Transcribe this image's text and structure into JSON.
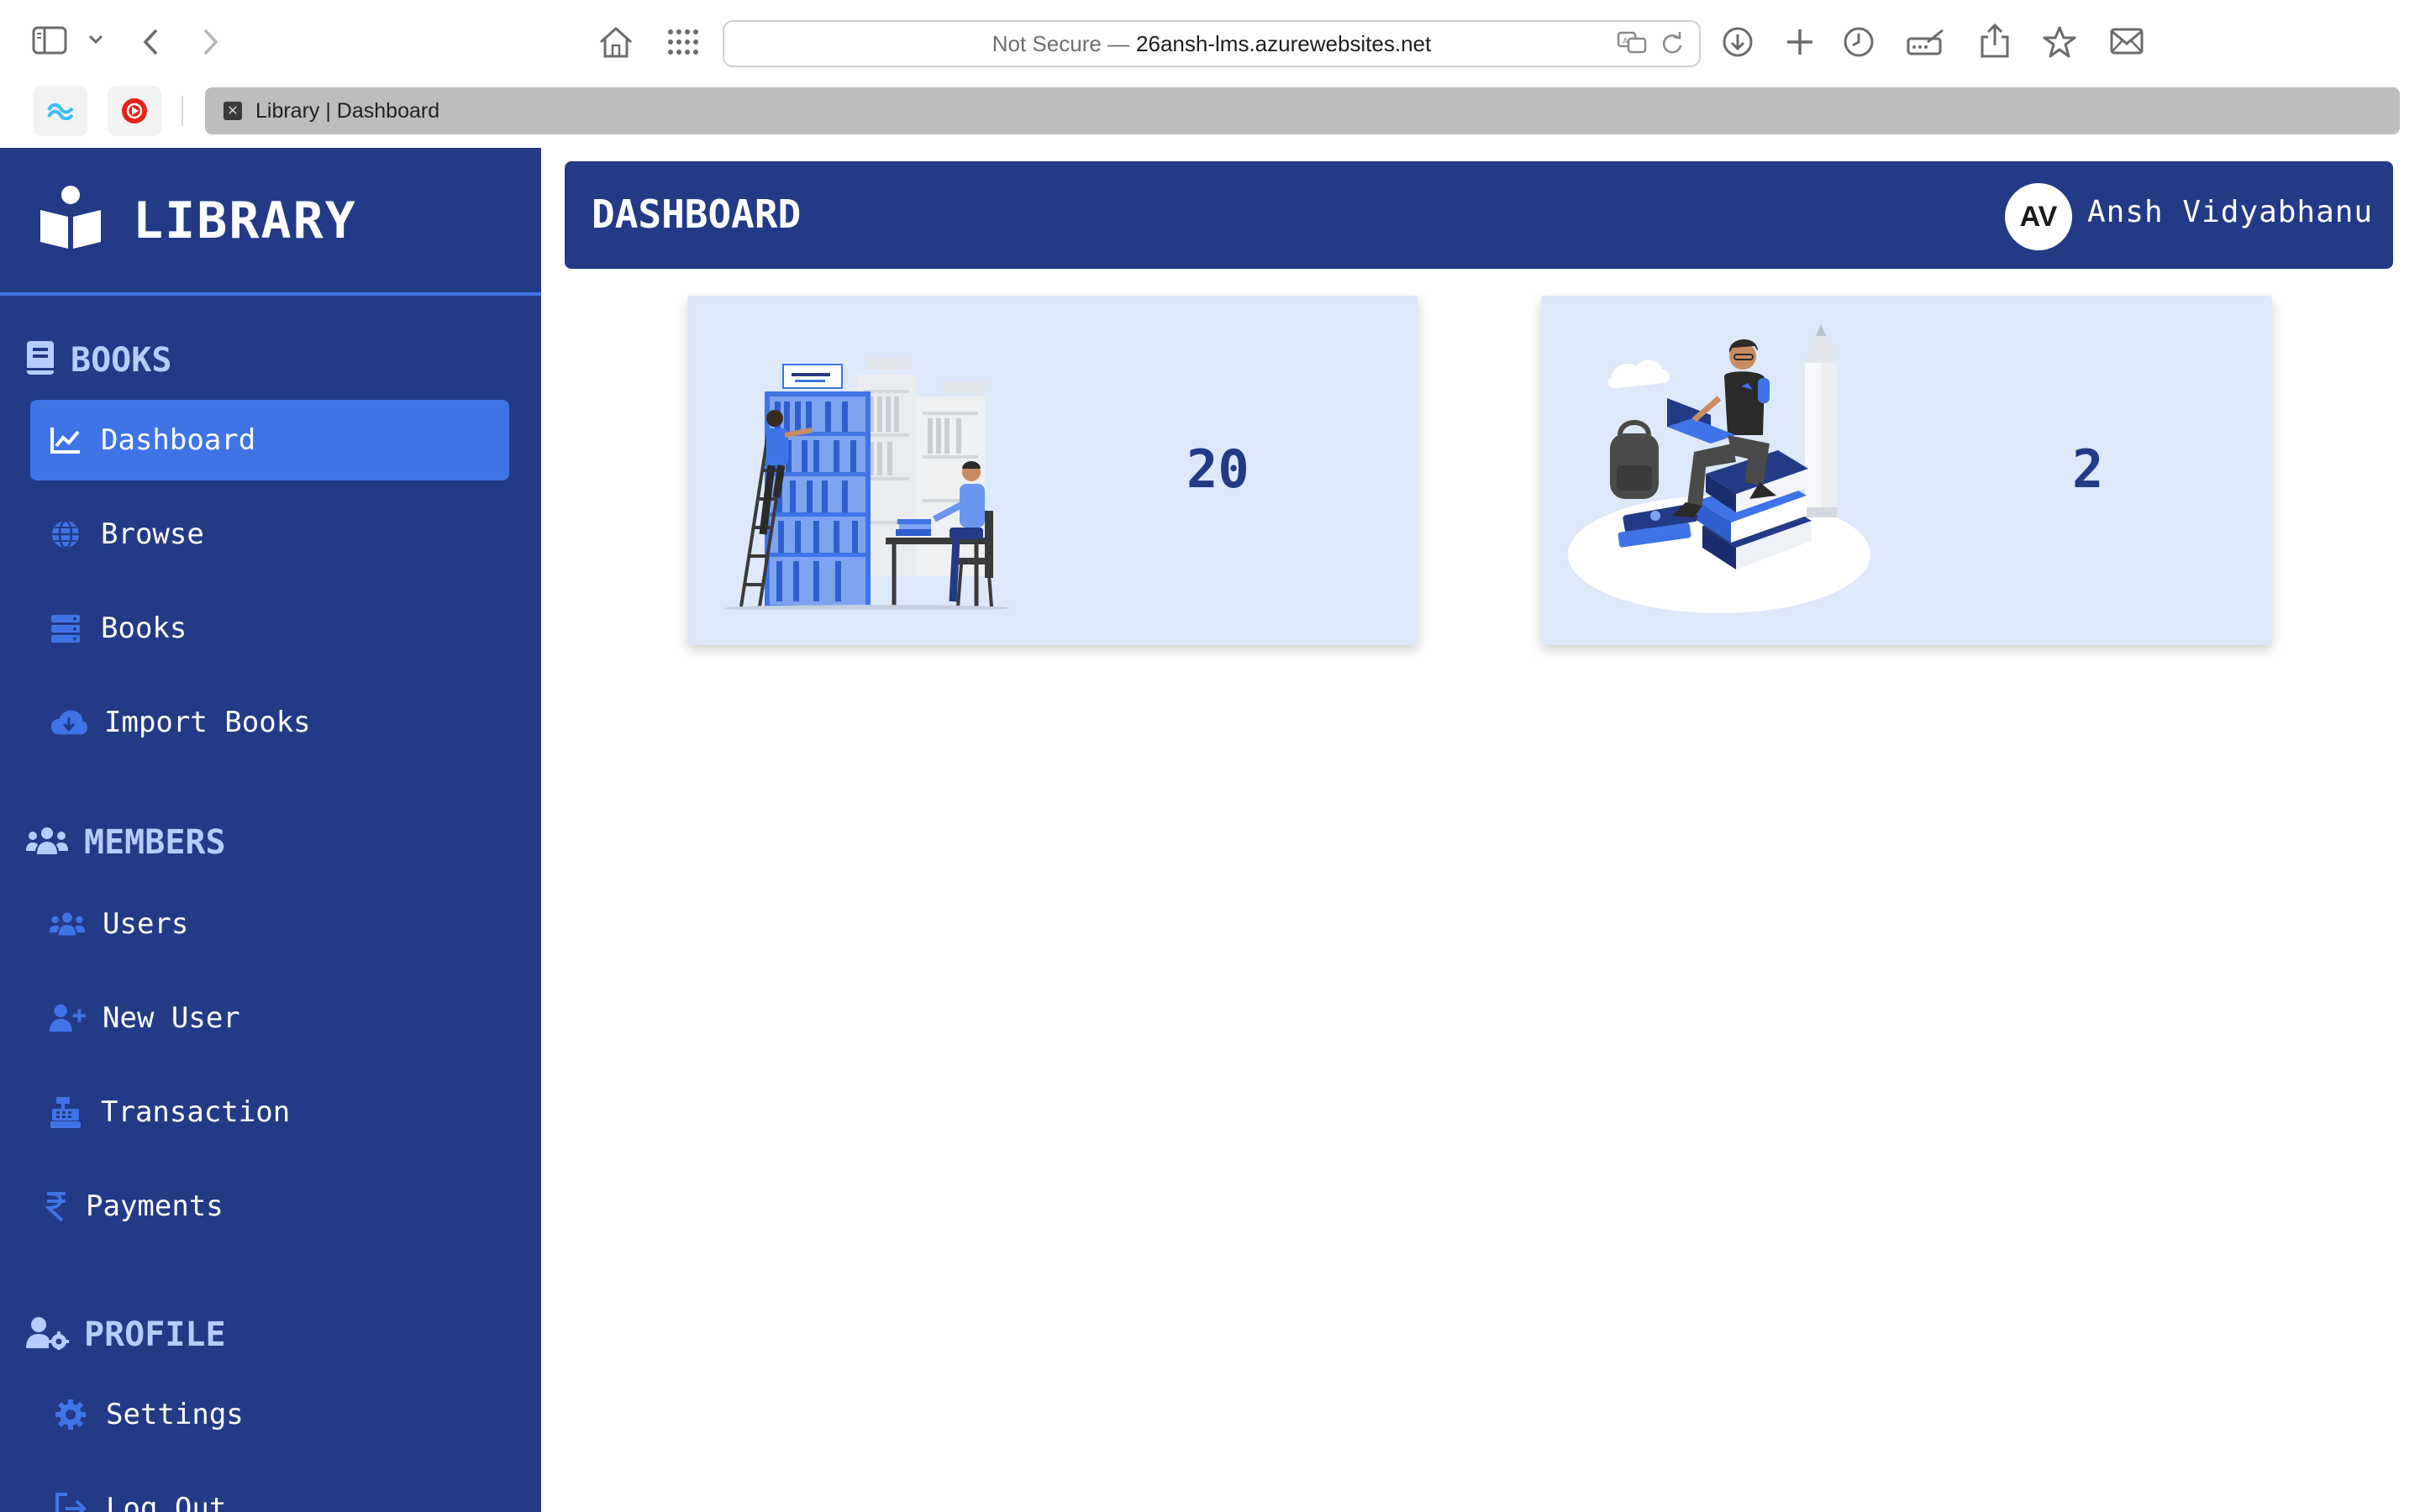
{
  "browser": {
    "url_prefix": "Not Secure —",
    "url_host": "26ansh-lms.azurewebsites.net",
    "tab_title": "Library | Dashboard"
  },
  "sidebar": {
    "brand": "LIBRARY",
    "sections": [
      {
        "title": "BOOKS",
        "items": [
          {
            "label": "Dashboard",
            "active": true
          },
          {
            "label": "Browse"
          },
          {
            "label": "Books"
          },
          {
            "label": "Import Books"
          }
        ]
      },
      {
        "title": "MEMBERS",
        "items": [
          {
            "label": "Users"
          },
          {
            "label": "New User"
          },
          {
            "label": "Transaction"
          },
          {
            "label": "Payments"
          }
        ]
      },
      {
        "title": "PROFILE",
        "items": [
          {
            "label": "Settings"
          },
          {
            "label": "Log Out"
          }
        ]
      }
    ]
  },
  "header": {
    "title": "DASHBOARD",
    "avatar_initials": "AV",
    "user_name": "Ansh Vidyabhanu"
  },
  "cards": [
    {
      "value": "20",
      "illustration": "library-shelves-illustration"
    },
    {
      "value": "2",
      "illustration": "student-on-books-illustration"
    }
  ],
  "colors": {
    "sidebar_bg": "#233a86",
    "accent": "#3f74e6",
    "card_bg": "#dde8f9",
    "section_title": "#b7ccff"
  }
}
